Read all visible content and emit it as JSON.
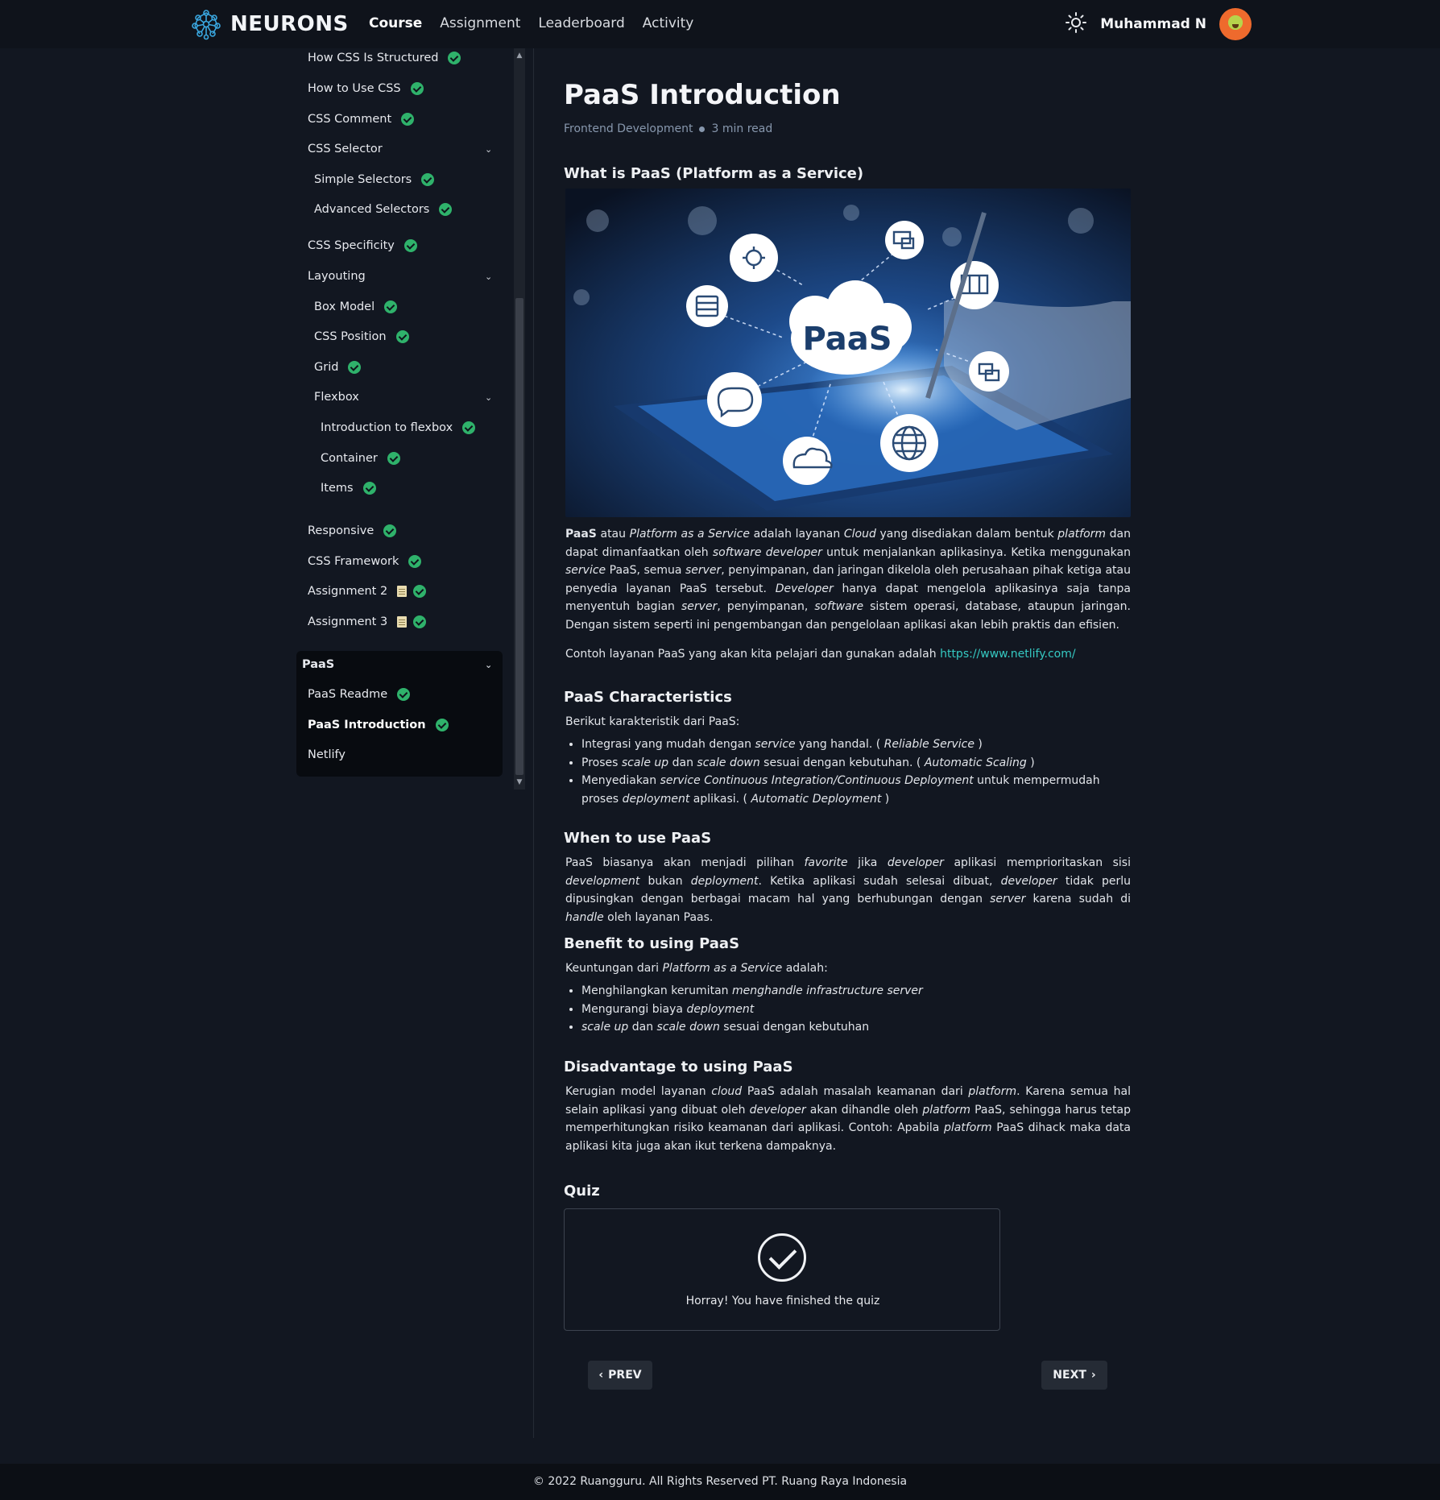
{
  "header": {
    "brand": "NEURONS",
    "nav": [
      "Course",
      "Assignment",
      "Leaderboard",
      "Activity"
    ],
    "active_nav": "Course",
    "user_name": "Muhammad N"
  },
  "sidebar": {
    "items": [
      {
        "label": "How CSS Is Structured",
        "status": "done"
      },
      {
        "label": "How to Use CSS",
        "status": "done"
      },
      {
        "label": "CSS Comment",
        "status": "done"
      },
      {
        "label": "CSS Selector",
        "status": "expanded"
      },
      {
        "label": "Simple Selectors",
        "status": "done"
      },
      {
        "label": "Advanced Selectors",
        "status": "done"
      },
      {
        "label": "CSS Specificity",
        "status": "done"
      },
      {
        "label": "Layouting",
        "status": "expanded"
      },
      {
        "label": "Box Model",
        "status": "done"
      },
      {
        "label": "CSS Position",
        "status": "done"
      },
      {
        "label": "Grid",
        "status": "done"
      },
      {
        "label": "Flexbox",
        "status": "expanded"
      },
      {
        "label": "Introduction to flexbox",
        "status": "done"
      },
      {
        "label": "Container",
        "status": "done"
      },
      {
        "label": "Items",
        "status": "done"
      },
      {
        "label": "Responsive",
        "status": "done"
      },
      {
        "label": "CSS Framework",
        "status": "done"
      },
      {
        "label": "Assignment 2",
        "status": "done"
      },
      {
        "label": "Assignment 3",
        "status": "done"
      },
      {
        "label": "PaaS",
        "status": "expanded"
      },
      {
        "label": "PaaS Readme",
        "status": "done"
      },
      {
        "label": "PaaS Introduction",
        "status": "done"
      },
      {
        "label": "Netlify",
        "status": "none"
      }
    ]
  },
  "article": {
    "title": "PaaS Introduction",
    "category": "Frontend Development",
    "read_time": "3 min read",
    "section1_title": "What is PaaS (Platform as a Service)",
    "hero_label": "PaaS",
    "link_url": "https://www.netlify.com/",
    "section2_title": "PaaS Characteristics",
    "section2_intro": "Berikut karakteristik dari PaaS:",
    "section3_title": "When to use PaaS",
    "section4_title": "Benefit to using PaaS",
    "section5_title": "Disadvantage to using PaaS"
  },
  "quiz": {
    "title": "Quiz",
    "message": "Horray! You have finished the quiz"
  },
  "pager": {
    "prev": "PREV",
    "next": "NEXT"
  },
  "footer": {
    "text": "© 2022 Ruangguru. All Rights Reserved PT. Ruang Raya Indonesia"
  },
  "colors": {
    "background": "#121721",
    "header": "#0f131b",
    "check": "#2fb26b",
    "link": "#35c9c2"
  }
}
